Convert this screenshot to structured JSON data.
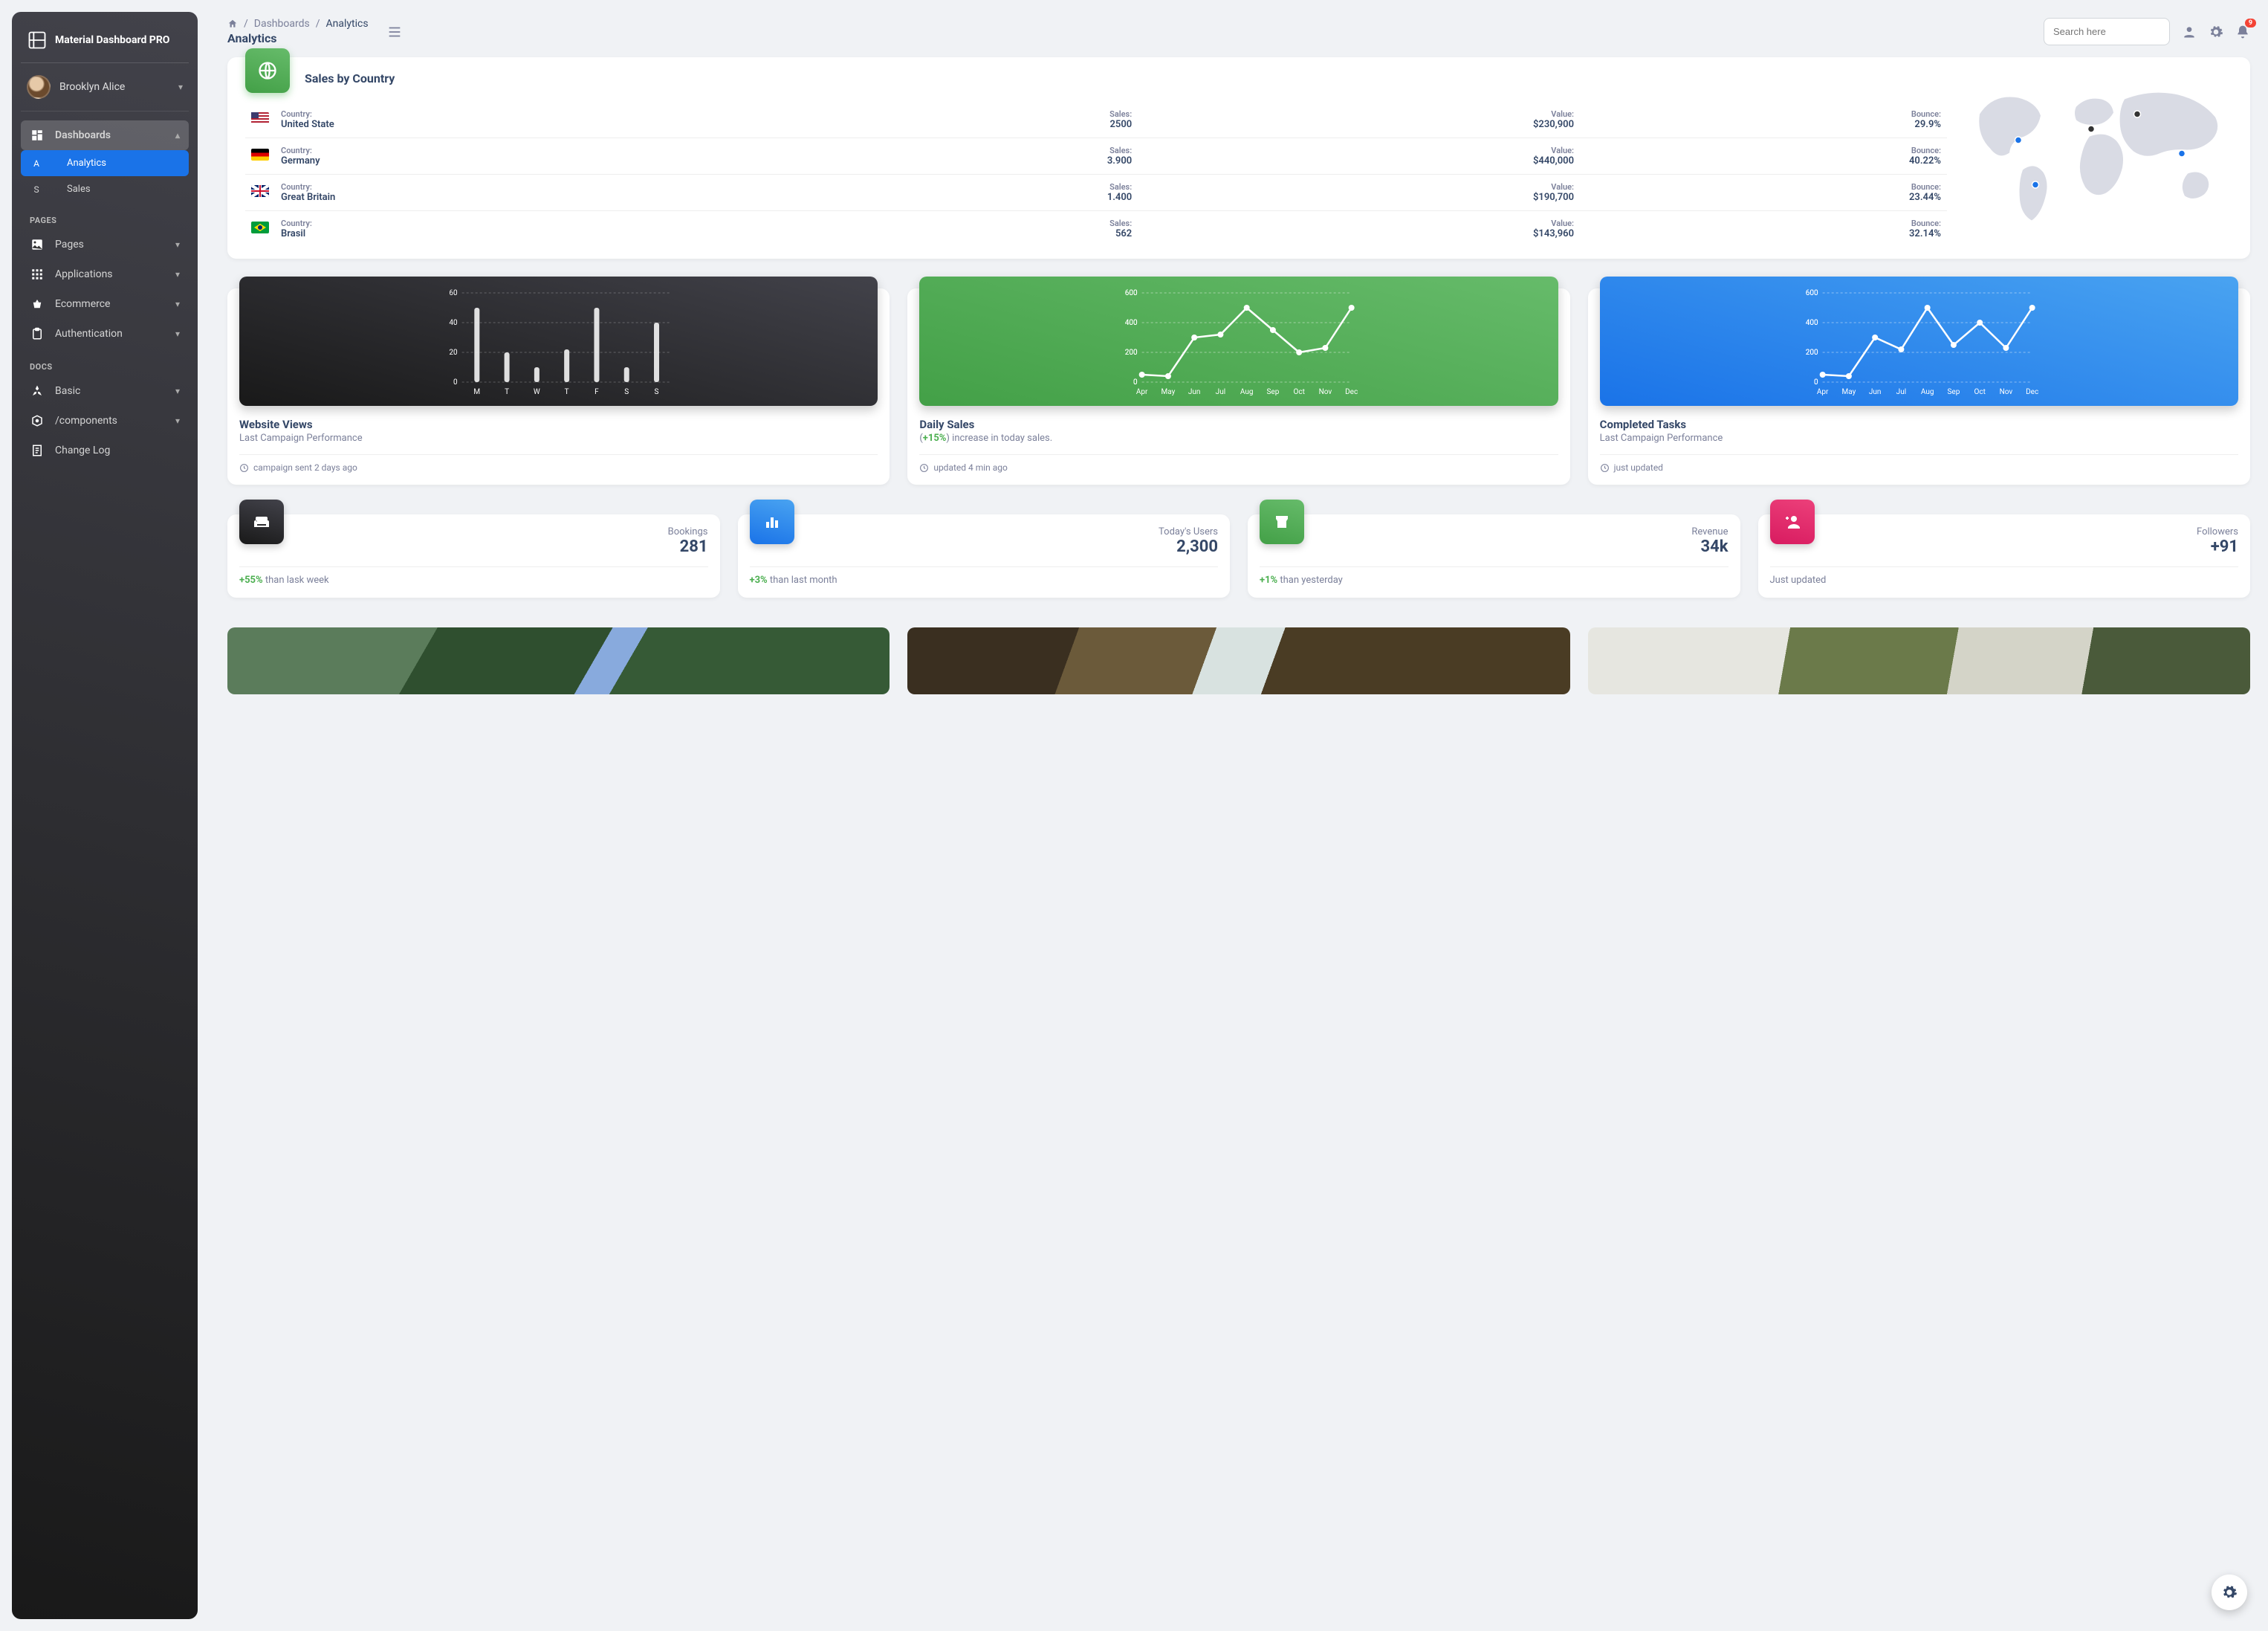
{
  "brand": {
    "title": "Material Dashboard PRO"
  },
  "user": {
    "name": "Brooklyn Alice"
  },
  "nav": {
    "dashboards": "Dashboards",
    "analytics": "Analytics",
    "sales": "Sales",
    "section_pages": "PAGES",
    "pages": "Pages",
    "applications": "Applications",
    "ecommerce": "Ecommerce",
    "authentication": "Authentication",
    "section_docs": "DOCS",
    "basic": "Basic",
    "components": "/components",
    "changelog": "Change Log"
  },
  "breadcrumb": {
    "dashboards": "Dashboards",
    "current": "Analytics",
    "title": "Analytics"
  },
  "search": {
    "placeholder": "Search here"
  },
  "notifications": {
    "count": "9"
  },
  "countryCard": {
    "title": "Sales by Country",
    "labels": {
      "country": "Country:",
      "sales": "Sales:",
      "value": "Value:",
      "bounce": "Bounce:"
    },
    "rows": [
      {
        "flag": "us",
        "country": "United State",
        "sales": "2500",
        "value": "$230,900",
        "bounce": "29.9%"
      },
      {
        "flag": "de",
        "country": "Germany",
        "sales": "3.900",
        "value": "$440,000",
        "bounce": "40.22%"
      },
      {
        "flag": "gb",
        "country": "Great Britain",
        "sales": "1.400",
        "value": "$190,700",
        "bounce": "23.44%"
      },
      {
        "flag": "br",
        "country": "Brasil",
        "sales": "562",
        "value": "$143,960",
        "bounce": "32.14%"
      }
    ]
  },
  "chart_data": [
    {
      "type": "bar",
      "categories": [
        "M",
        "T",
        "W",
        "T",
        "F",
        "S",
        "S"
      ],
      "values": [
        50,
        20,
        10,
        22,
        50,
        10,
        40
      ],
      "ylim": [
        0,
        60
      ],
      "yticks": [
        0,
        20,
        40,
        60
      ],
      "title": "Website Views",
      "subtitle": "Last Campaign Performance",
      "footer": "campaign sent 2 days ago"
    },
    {
      "type": "line",
      "categories": [
        "Apr",
        "May",
        "Jun",
        "Jul",
        "Aug",
        "Sep",
        "Oct",
        "Nov",
        "Dec"
      ],
      "values": [
        50,
        40,
        300,
        320,
        500,
        350,
        200,
        230,
        500
      ],
      "ylim": [
        0,
        600
      ],
      "yticks": [
        0,
        200,
        400,
        600
      ],
      "title": "Daily Sales",
      "subtitle_prefix": "(",
      "subtitle_delta": "+15%",
      "subtitle_suffix": ") increase in today sales.",
      "footer": "updated 4 min ago"
    },
    {
      "type": "line",
      "categories": [
        "Apr",
        "May",
        "Jun",
        "Jul",
        "Aug",
        "Sep",
        "Oct",
        "Nov",
        "Dec"
      ],
      "values": [
        50,
        40,
        300,
        220,
        500,
        250,
        400,
        230,
        500
      ],
      "ylim": [
        0,
        600
      ],
      "yticks": [
        0,
        200,
        400,
        600
      ],
      "title": "Completed Tasks",
      "subtitle": "Last Campaign Performance",
      "footer": "just updated"
    }
  ],
  "stats": [
    {
      "icon": "weekend",
      "color": "dark",
      "label": "Bookings",
      "value": "281",
      "delta": "+55%",
      "delta_text": " than lask week"
    },
    {
      "icon": "bar",
      "color": "blue",
      "label": "Today's Users",
      "value": "2,300",
      "delta": "+3%",
      "delta_text": " than last month"
    },
    {
      "icon": "store",
      "color": "green",
      "label": "Revenue",
      "value": "34k",
      "delta": "+1%",
      "delta_text": " than yesterday"
    },
    {
      "icon": "personadd",
      "color": "pink",
      "label": "Followers",
      "value": "+91",
      "delta": "",
      "delta_text": "Just updated"
    }
  ]
}
